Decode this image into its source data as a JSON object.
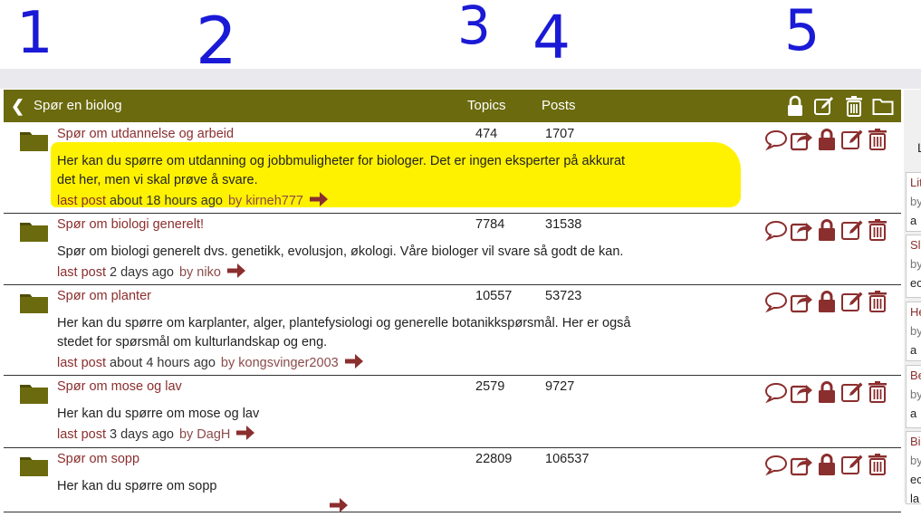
{
  "annotations": [
    "1",
    "2",
    "3",
    "4",
    "5"
  ],
  "header": {
    "title": "Spør en biolog",
    "col_topics": "Topics",
    "col_posts": "Posts"
  },
  "labels": {
    "last_post": "last post",
    "by": "by"
  },
  "forums": [
    {
      "name": "Spør om utdannelse og arbeid",
      "topics": "474",
      "posts": "1707",
      "desc_lines": [
        "Her kan du spørre om utdanning og jobbmuligheter for biologer. Det er ingen eksperter på akkurat",
        "det her, men vi skal prøve å svare."
      ],
      "last_time": "about 18 hours ago",
      "last_user": "kirneh777",
      "highlighted": true
    },
    {
      "name": "Spør om biologi generelt!",
      "topics": "7784",
      "posts": "31538",
      "desc_lines": [
        "Spør om biologi generelt dvs. genetikk, evolusjon, økologi. Våre biologer vil svare så godt de kan."
      ],
      "last_time": "2 days ago",
      "last_user": "niko",
      "highlighted": false
    },
    {
      "name": "Spør om planter",
      "topics": "10557",
      "posts": "53723",
      "desc_lines": [
        "Her kan du spørre om karplanter, alger, plantefysiologi og generelle botanikkspørsmål. Her er også",
        "stedet for spørsmål om kulturlandskap og eng."
      ],
      "last_time": "about 4 hours ago",
      "last_user": "kongsvinger2003",
      "highlighted": false
    },
    {
      "name": "Spør om mose og lav",
      "topics": "2579",
      "posts": "9727",
      "desc_lines": [
        "Her kan du spørre om mose og lav"
      ],
      "last_time": "3 days ago",
      "last_user": "DagH",
      "highlighted": false
    },
    {
      "name": "Spør om sopp",
      "topics": "22809",
      "posts": "106537",
      "desc_lines": [
        "Her kan du spørre om sopp"
      ],
      "last_time": "",
      "last_user": "",
      "highlighted": false
    }
  ],
  "sidebar": {
    "boxes": [
      {
        "lines": [
          "Lit",
          "by",
          "a"
        ]
      },
      {
        "lines": [
          "Sl",
          "by",
          "ec"
        ]
      },
      {
        "lines": [
          "He",
          "by",
          "a"
        ]
      },
      {
        "lines": [
          "Be",
          "by",
          "a"
        ]
      },
      {
        "lines": [
          "Bi",
          "by",
          "ec",
          "la"
        ]
      }
    ],
    "top_char": "L"
  },
  "colors": {
    "header_bg": "#6b6a0e",
    "accent": "#8b2e2e",
    "highlight": "#fff200",
    "annotation_ink": "#1a1ad6"
  },
  "icons": {
    "header": [
      "lock-icon",
      "edit-icon",
      "trash-icon",
      "folder-outline-icon"
    ],
    "row": [
      "comment-icon",
      "share-icon",
      "lock-icon",
      "edit-icon",
      "trash-icon"
    ]
  }
}
